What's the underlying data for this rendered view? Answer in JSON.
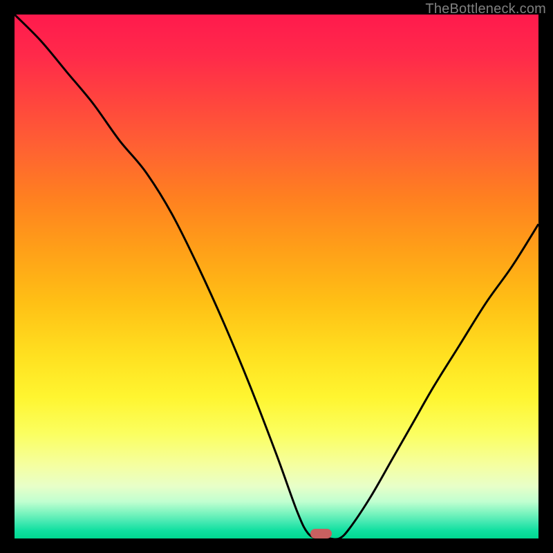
{
  "watermark": "TheBottleneck.com",
  "colors": {
    "background": "#000000",
    "curve_stroke": "#000000",
    "marker_fill": "#c86060"
  },
  "chart_data": {
    "type": "line",
    "title": "",
    "xlabel": "",
    "ylabel": "",
    "xlim": [
      0,
      100
    ],
    "ylim": [
      0,
      100
    ],
    "series": [
      {
        "name": "bottleneck-curve",
        "x": [
          0,
          5,
          10,
          15,
          20,
          25,
          30,
          35,
          40,
          45,
          50,
          54,
          56,
          58,
          60,
          62,
          64,
          68,
          72,
          76,
          80,
          85,
          90,
          95,
          100
        ],
        "values": [
          100,
          95,
          89,
          83,
          76,
          70,
          62,
          52,
          41,
          29,
          16,
          5,
          1,
          0,
          0,
          0,
          2,
          8,
          15,
          22,
          29,
          37,
          45,
          52,
          60
        ]
      }
    ],
    "min_point": {
      "x": 59,
      "y": 0
    },
    "marker_bounds": {
      "x_start": 56.5,
      "x_end": 60.5,
      "y": 0
    }
  }
}
